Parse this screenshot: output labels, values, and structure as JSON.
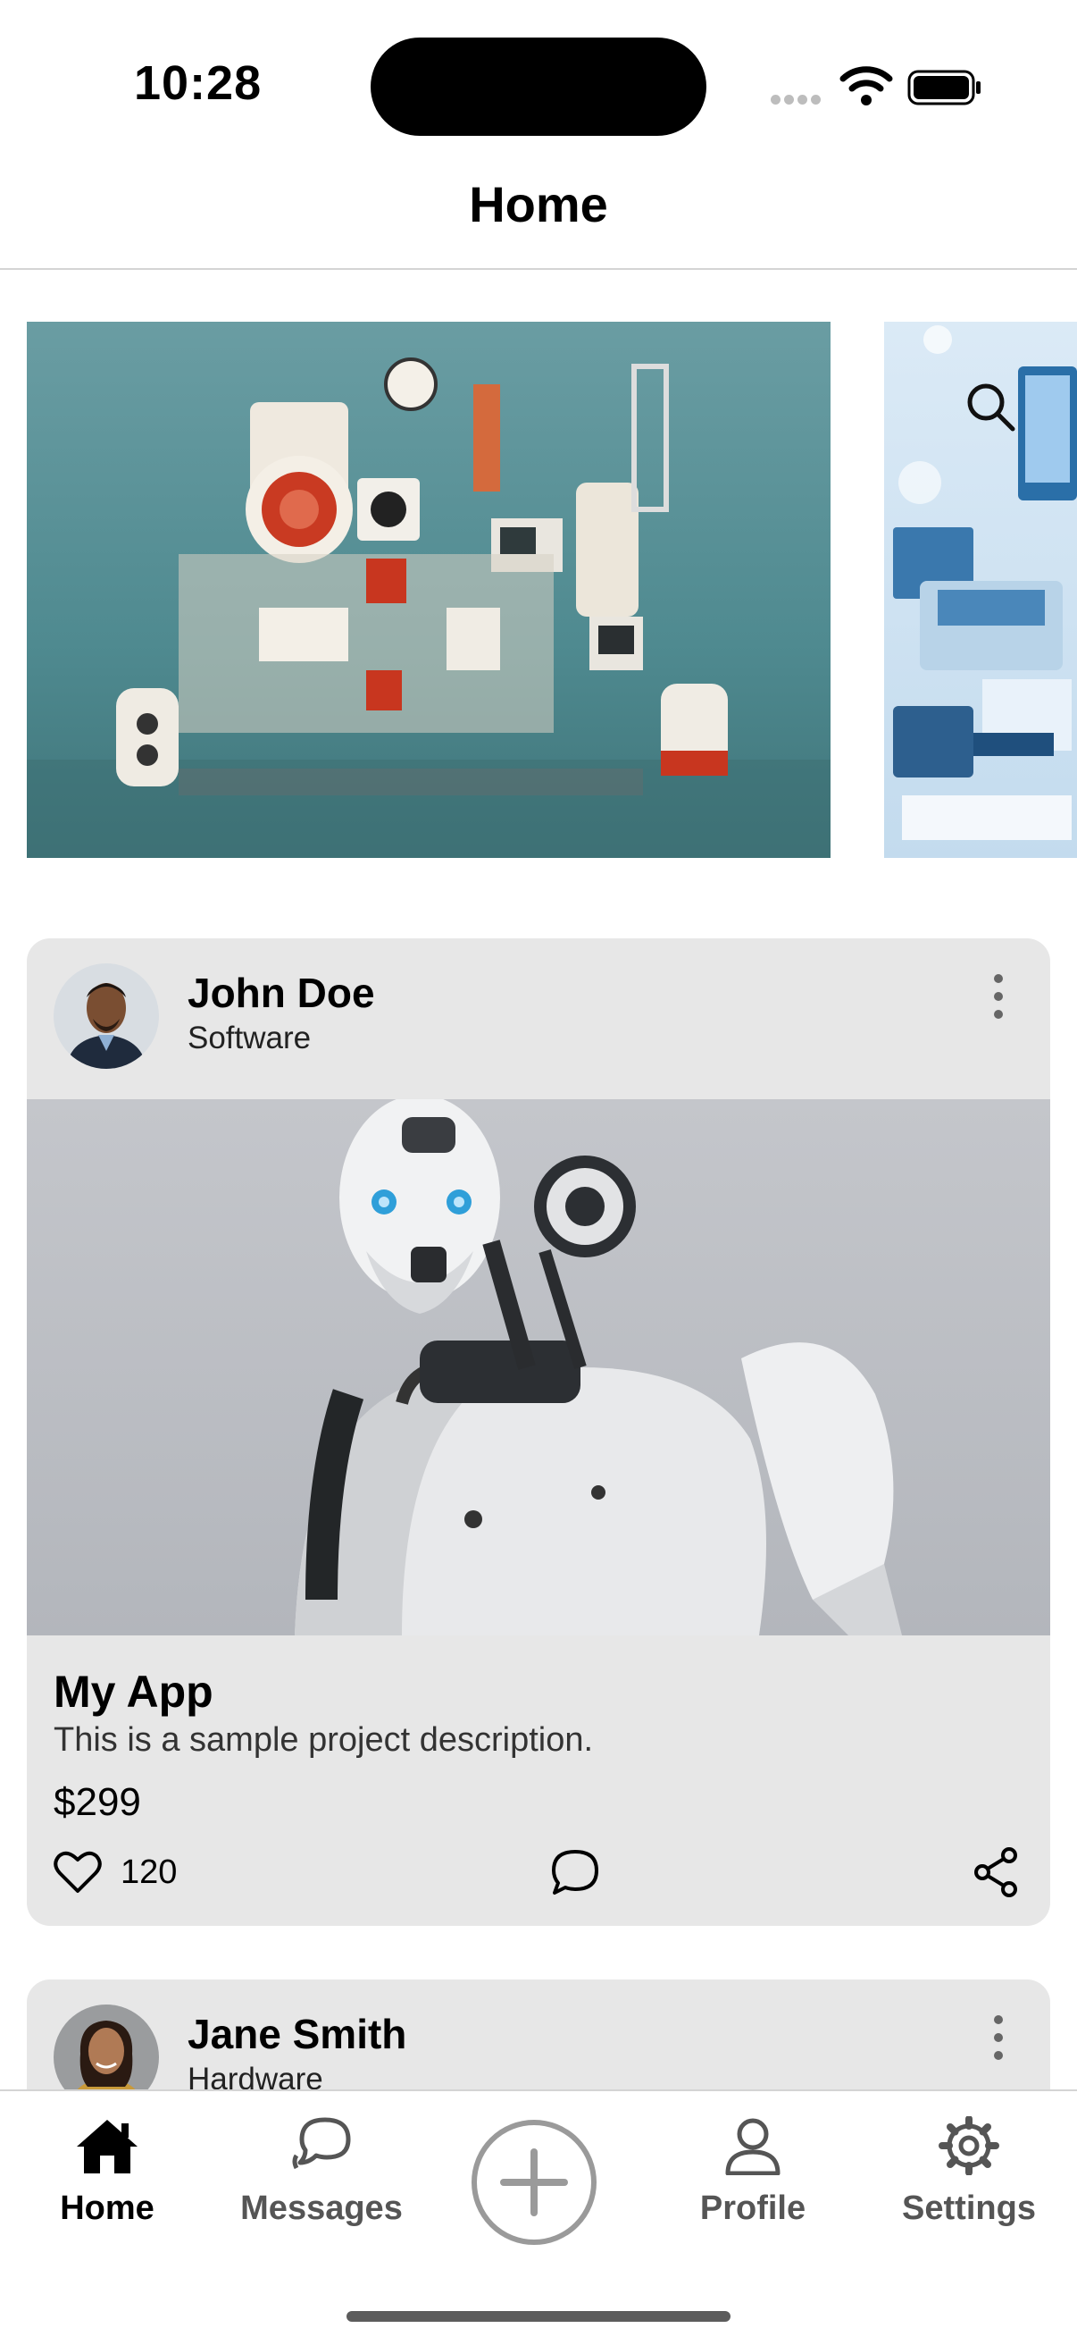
{
  "status_bar": {
    "time": "10:28"
  },
  "nav": {
    "title": "Home"
  },
  "carousel": [
    {
      "name": "electronics-collage-image"
    },
    {
      "name": "technology-illustration-image"
    }
  ],
  "posts": [
    {
      "author": "John Doe",
      "category": "Software",
      "project_title": "My App",
      "description": "This is a sample project description.",
      "price": "$299",
      "likes": "120"
    },
    {
      "author": "Jane Smith",
      "category": "Hardware"
    }
  ],
  "tabs": {
    "home": "Home",
    "messages": "Messages",
    "profile": "Profile",
    "settings": "Settings"
  },
  "colors": {
    "card_bg": "#e7e7e7",
    "active_tab": "#000000",
    "inactive_tab": "#555555"
  }
}
